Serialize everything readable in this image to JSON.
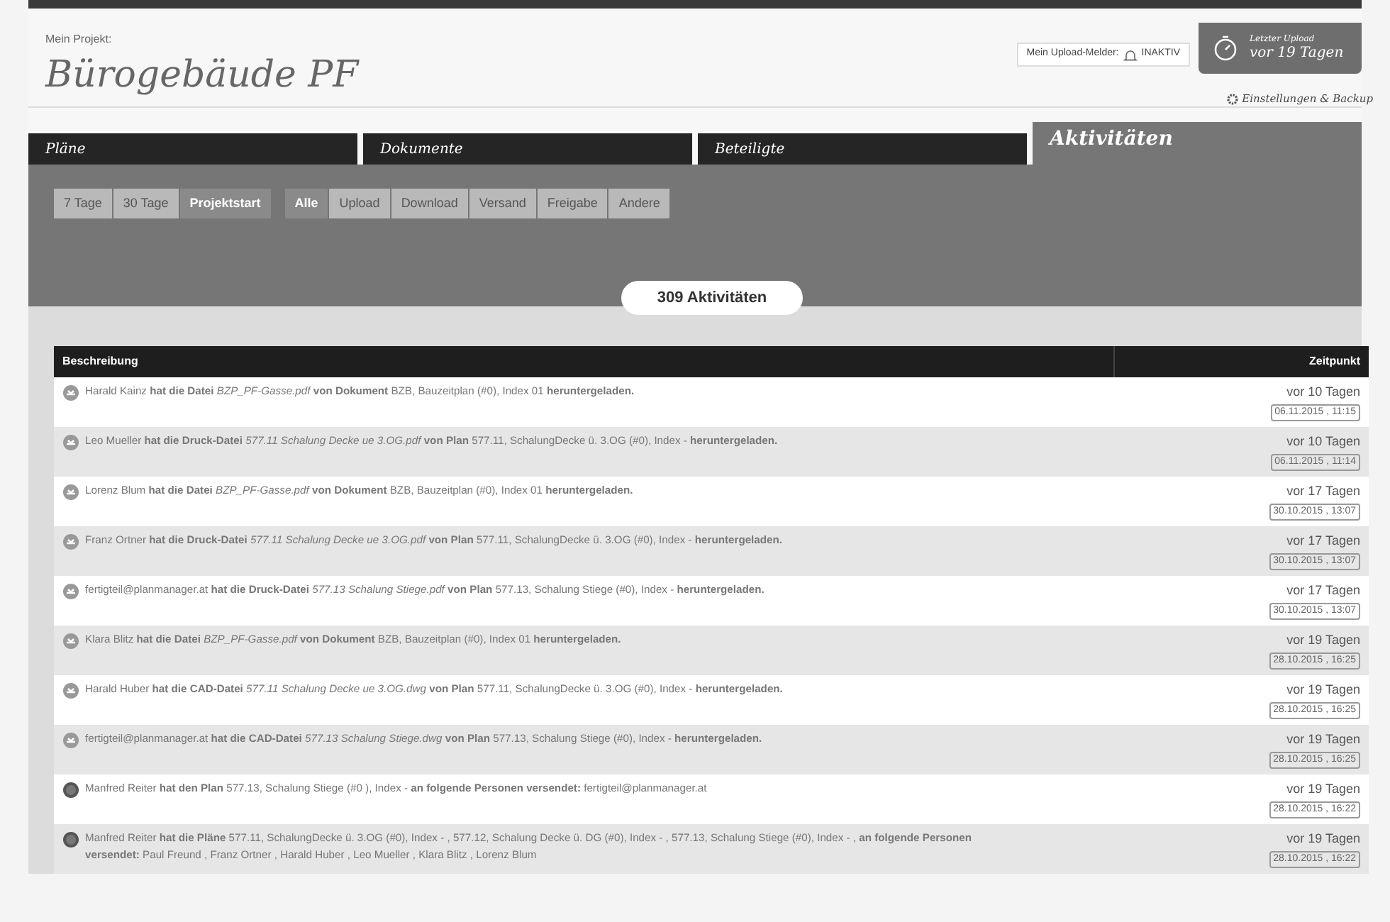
{
  "project": {
    "label": "Mein Projekt:",
    "title": "Bürogebäude PF"
  },
  "upload_notifier": {
    "label": "Mein Upload-Melder:",
    "status": "INAKTIV",
    "on": false
  },
  "last_upload": {
    "label": "Letzter Upload",
    "value": "vor 19 Tagen"
  },
  "settings_link": "Einstellungen & Backup",
  "tabs": [
    {
      "label": "Pläne",
      "selected": false
    },
    {
      "label": "Dokumente",
      "selected": false
    },
    {
      "label": "Beteiligte",
      "selected": false
    },
    {
      "label": "Aktivitäten",
      "selected": true
    }
  ],
  "period_filters": [
    {
      "label": "7 Tage",
      "selected": false
    },
    {
      "label": "30 Tage",
      "selected": false
    },
    {
      "label": "Projektstart",
      "selected": true
    }
  ],
  "type_filters": [
    {
      "label": "Alle",
      "selected": true
    },
    {
      "label": "Upload",
      "selected": false
    },
    {
      "label": "Download",
      "selected": false
    },
    {
      "label": "Versand",
      "selected": false
    },
    {
      "label": "Freigabe",
      "selected": false
    },
    {
      "label": "Andere",
      "selected": false
    }
  ],
  "count": "309 Aktivitäten",
  "table": {
    "columns": [
      "Beschreibung",
      "Zeitpunkt"
    ],
    "rows": [
      {
        "kind": "download",
        "description": "Harald Kainz **hat die Datei** *BZP_PF-Gasse.pdf* **von Dokument** BZB, Bauzeitplan (#0), Index 01 **heruntergeladen.**",
        "ago": "vor 10 Tagen",
        "date": "06.11.2015 , 11:15"
      },
      {
        "kind": "download",
        "description": "Leo Mueller **hat die Druck-Datei** *577.11 Schalung Decke ue 3.OG.pdf* **von Plan** 577.11, SchalungDecke ü. 3.OG (#0), Index - **heruntergeladen.**",
        "ago": "vor 10 Tagen",
        "date": "06.11.2015 , 11:14"
      },
      {
        "kind": "download",
        "description": "Lorenz Blum **hat die Datei** *BZP_PF-Gasse.pdf* **von Dokument** BZB, Bauzeitplan (#0), Index 01 **heruntergeladen.**",
        "ago": "vor 17 Tagen",
        "date": "30.10.2015 , 13:07"
      },
      {
        "kind": "download",
        "description": "Franz Ortner **hat die Druck-Datei** *577.11 Schalung Decke ue 3.OG.pdf* **von Plan** 577.11, SchalungDecke ü. 3.OG (#0), Index - **heruntergeladen.**",
        "ago": "vor 17 Tagen",
        "date": "30.10.2015 , 13:07"
      },
      {
        "kind": "download",
        "description": "fertigteil@planmanager.at **hat die Druck-Datei** *577.13 Schalung Stiege.pdf* **von Plan** 577.13, Schalung Stiege (#0), Index - **heruntergeladen.**",
        "ago": "vor 17 Tagen",
        "date": "30.10.2015 , 13:07"
      },
      {
        "kind": "download",
        "description": "Klara Blitz **hat die Datei** *BZP_PF-Gasse.pdf* **von Dokument** BZB, Bauzeitplan (#0), Index 01 **heruntergeladen.**",
        "ago": "vor 19 Tagen",
        "date": "28.10.2015 , 16:25"
      },
      {
        "kind": "download",
        "description": "Harald Huber **hat die CAD-Datei** *577.11 Schalung Decke ue 3.OG.dwg* **von Plan** 577.11, SchalungDecke ü. 3.OG (#0), Index - **heruntergeladen.**",
        "ago": "vor 19 Tagen",
        "date": "28.10.2015 , 16:25"
      },
      {
        "kind": "download",
        "description": "fertigteil@planmanager.at **hat die CAD-Datei** *577.13 Schalung Stiege.dwg* **von Plan** 577.13, Schalung Stiege (#0), Index - **heruntergeladen.**",
        "ago": "vor 19 Tagen",
        "date": "28.10.2015 , 16:25"
      },
      {
        "kind": "send",
        "description": "Manfred Reiter **hat den Plan** 577.13, Schalung Stiege (#0 ), Index - **an folgende Personen versendet:** fertigteil@planmanager.at",
        "ago": "vor 19 Tagen",
        "date": "28.10.2015 , 16:22"
      },
      {
        "kind": "send",
        "description": "Manfred Reiter **hat die Pläne** 577.11, SchalungDecke ü. 3.OG (#0), Index - , 577.12, Schalung Decke ü. DG (#0), Index - , 577.13, Schalung Stiege (#0), Index - , **an folgende Personen versendet:** Paul Freund , Franz Ortner , Harald Huber , Leo Mueller , Klara Blitz , Lorenz Blum",
        "ago": "vor 19 Tagen",
        "date": "28.10.2015 , 16:22"
      }
    ]
  }
}
